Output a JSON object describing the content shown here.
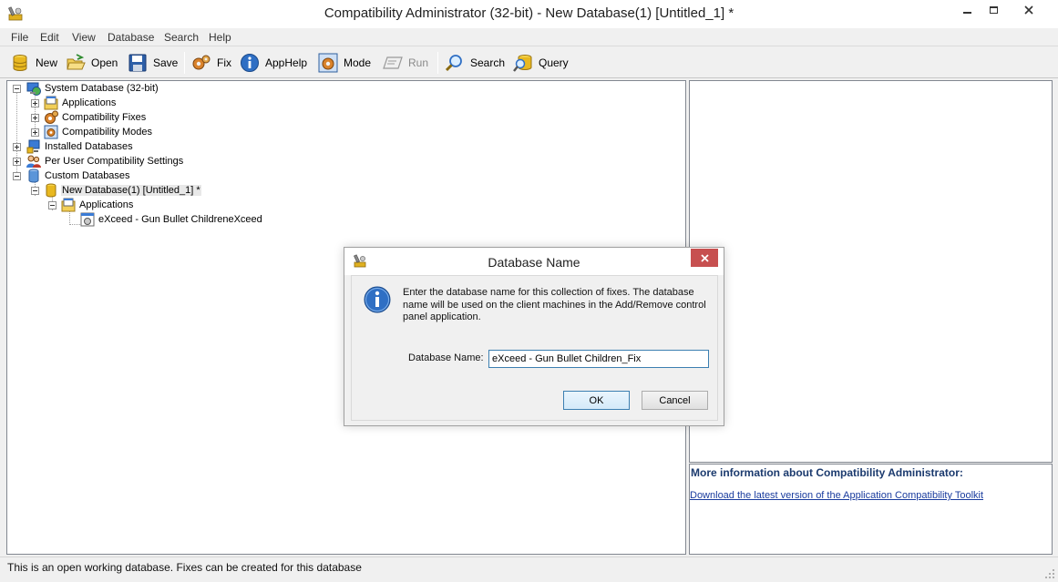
{
  "window": {
    "title": "Compatibility Administrator (32-bit) - New Database(1) [Untitled_1] *",
    "controls": [
      "minimize",
      "maximize",
      "close"
    ]
  },
  "menu": {
    "items": [
      "File",
      "Edit",
      "View",
      "Database",
      "Search",
      "Help"
    ]
  },
  "toolbar": {
    "new_label": "New",
    "open_label": "Open",
    "save_label": "Save",
    "fix_label": "Fix",
    "apphelp_label": "AppHelp",
    "mode_label": "Mode",
    "run_label": "Run",
    "search_label": "Search",
    "query_label": "Query"
  },
  "tree": {
    "system_db": "System Database (32-bit)",
    "applications": "Applications",
    "compat_fixes": "Compatibility Fixes",
    "compat_modes": "Compatibility Modes",
    "installed_dbs": "Installed Databases",
    "per_user": "Per User Compatibility Settings",
    "custom_dbs": "Custom Databases",
    "new_db": "New Database(1) [Untitled_1] *",
    "custom_applications": "Applications",
    "app_entry": "eXceed - Gun Bullet ChildreneXceed"
  },
  "info_panel": {
    "heading": "More information about Compatibility Administrator:",
    "link": "Download the latest version of the Application Compatibility Toolkit"
  },
  "status": {
    "text": "This is an open working database. Fixes can be created for this database"
  },
  "dialog": {
    "title": "Database Name",
    "message": "Enter the database name for this collection of fixes. The database name will be used on the client machines in the Add/Remove control panel application.",
    "field_label": "Database Name:",
    "field_value": "eXceed - Gun Bullet Children_Fix",
    "ok_label": "OK",
    "cancel_label": "Cancel"
  },
  "colors": {
    "dialog_close_bg": "#c75050",
    "link": "#1a3c9e",
    "heading": "#1b3a6e",
    "focus_border": "#3c7fb1"
  },
  "icons": [
    "app-icon",
    "new-db-icon",
    "open-icon",
    "save-icon",
    "fix-icon",
    "apphelp-icon",
    "mode-icon",
    "run-icon",
    "search-icon",
    "query-icon",
    "info-icon"
  ]
}
